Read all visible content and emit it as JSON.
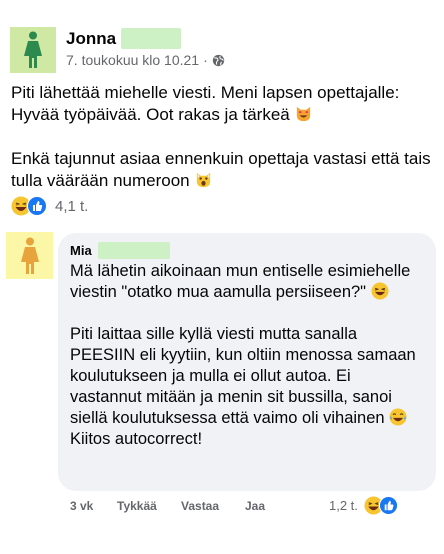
{
  "post": {
    "author": "Jonna",
    "timestamp": "7. toukokuu klo 10.21",
    "separator": "·",
    "audience_icon": "globe-icon",
    "paragraph1": "Piti lähettää miehelle viesti. Meni lapsen opettajalle: Hyvää työpäivää. Oot rakas ja tärkeä",
    "paragraph2": "Enkä tajunnut asiaa ennenkuin opettaja vastasi että tais tulla väärään numeroon",
    "reaction_count": "4,1 t."
  },
  "comment": {
    "author": "Mia",
    "paragraph1": "Mä lähetin aikoinaan mun entiselle esimiehelle viestin \"otatko mua aamulla persiiseen?\"",
    "paragraph2a": "Piti laittaa sille kyllä viesti mutta sanalla PEESIIN eli kyytiin, kun oltiin menossa samaan koulutukseen ja mulla ei ollut autoa. Ei vastannut mitään ja menin sit bussilla, sanoi siellä koulutuksessa että vaimo oli vihainen",
    "paragraph2b": "Kiitos autocorrect!",
    "time": "3 vk",
    "like_label": "Tykkää",
    "reply_label": "Vastaa",
    "share_label": "Jaa",
    "reaction_count": "1,2 t."
  },
  "colors": {
    "post_avatar_bg": "#cfe8a4",
    "comment_avatar_bg": "#fbf7a6",
    "like_blue": "#1877f2",
    "emoji_yellow": "#f7c52f",
    "bubble_bg": "#f0f2f5"
  }
}
